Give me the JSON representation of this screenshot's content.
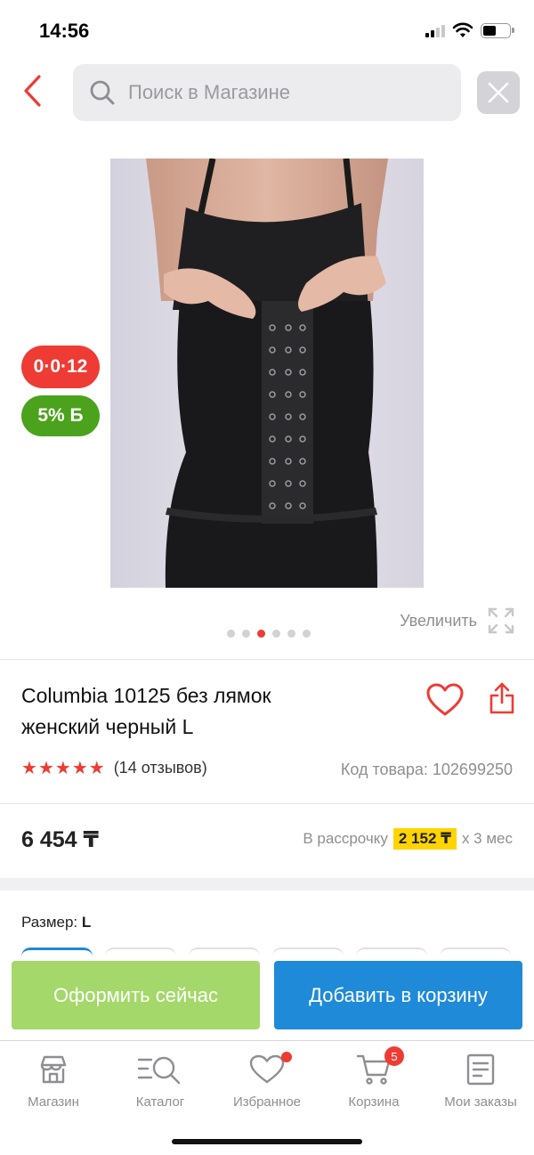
{
  "status_bar": {
    "time": "14:56"
  },
  "header": {
    "search_placeholder": "Поиск в Магазине"
  },
  "product": {
    "badge_installment": "0·0·12",
    "badge_bonus": "5% Б",
    "zoom_label": "Увеличить",
    "title_line1": "Columbia 10125 без лямок",
    "title_line2": "женский черный L",
    "rating_stars": 5,
    "reviews": "(14 отзывов)",
    "product_code": "Код товара: 102699250",
    "price": "6 454 ₸",
    "installment_prefix": "В рассрочку",
    "installment_amount": "2 152 ₸",
    "installment_suffix": "х 3 мес",
    "size_label": "Размер:",
    "size_value": "L",
    "image_count": 6,
    "active_image": 3
  },
  "actions": {
    "order_now": "Оформить сейчас",
    "add_to_cart": "Добавить в корзину"
  },
  "tabbar": {
    "items": [
      {
        "label": "Магазин"
      },
      {
        "label": "Каталог"
      },
      {
        "label": "Избранное"
      },
      {
        "label": "Корзина",
        "badge": "5"
      },
      {
        "label": "Мои заказы"
      }
    ]
  },
  "colors": {
    "accent_red": "#ee3b34",
    "green": "#4ba21c",
    "blue": "#1f8ad8",
    "light_green": "#a4d86a",
    "yellow": "#ffd400"
  }
}
